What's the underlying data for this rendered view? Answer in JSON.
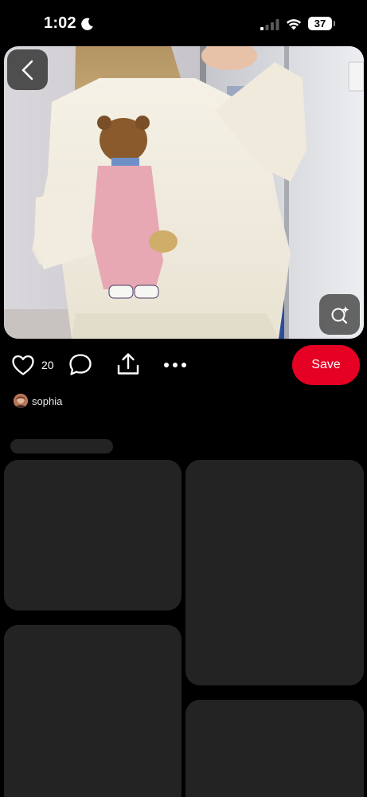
{
  "status_bar": {
    "time": "1:02",
    "battery": "37",
    "icons": [
      "moon-icon",
      "signal-icon",
      "wifi-icon",
      "battery-icon"
    ]
  },
  "pin": {
    "image_icon_names": [
      "back-chevron-icon",
      "visual-search-icon"
    ],
    "likes": "20",
    "save_label": "Save",
    "author": "sophia",
    "action_icons": [
      "heart-icon",
      "comment-icon",
      "share-icon",
      "more-dots-icon"
    ]
  },
  "colors": {
    "background": "#000000",
    "accent": "#e60023",
    "placeholder": "#232323"
  }
}
